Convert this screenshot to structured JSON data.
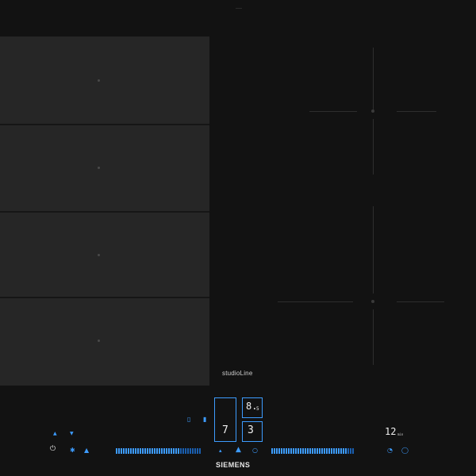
{
  "model_label": "studioLine",
  "brand": "SIEMENS",
  "displays": {
    "zone_upper": "8.",
    "zone_upper_sub": "5",
    "zone_left": "7",
    "zone_right": "3",
    "timer_value": "12",
    "timer_unit": "min"
  },
  "colors": {
    "accent": "#3d9cff",
    "glass": "#121212",
    "zone_fill": "#262626"
  },
  "icons": {
    "power": "power-icon",
    "lock": "lock-icon",
    "fan": "fan-icon",
    "flex": "flex-zone-icon",
    "timer": "timer-icon"
  }
}
